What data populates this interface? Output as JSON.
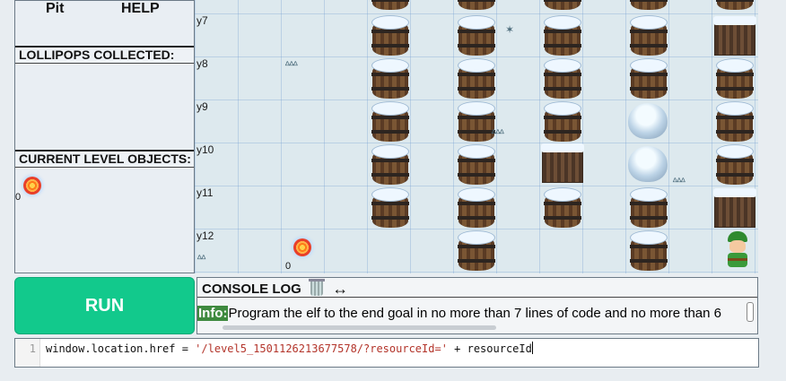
{
  "left_panel": {
    "tabs": [
      {
        "label": "Pit"
      },
      {
        "label": "HELP"
      }
    ],
    "lollipops_header": "LOLLIPOPS COLLECTED:",
    "objects_header": "CURRENT LEVEL OBJECTS:",
    "objects_count": "0"
  },
  "board": {
    "row_labels": [
      "y7",
      "y8",
      "y9",
      "y10",
      "y11",
      "y12"
    ],
    "lollipop_count": "0"
  },
  "run_button": {
    "label": "RUN"
  },
  "console": {
    "title": "CONSOLE LOG",
    "resize_icon": "↔",
    "log": {
      "tag": "Info:",
      "message": "Program the elf to the end goal in no more than 7 lines of code and no more than 6"
    }
  },
  "editor": {
    "line_number": "1",
    "code_prefix": "window.location.href = ",
    "code_string": "'/level5_1501126213677578/?resourceId='",
    "code_suffix": " + resourceId"
  }
}
